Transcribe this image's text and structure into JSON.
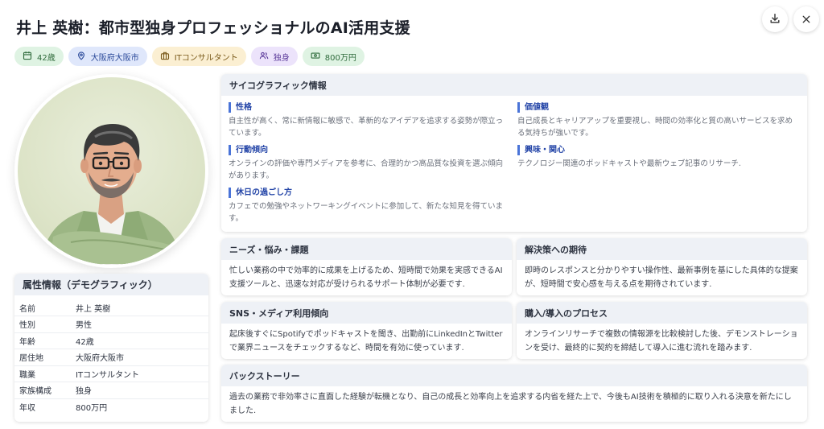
{
  "header": {
    "title": "井上 英樹：都市型独身プロフェッショナルのAI活用支援",
    "download_icon": "download-icon",
    "close_icon": "close-icon"
  },
  "tags": [
    {
      "icon": "calendar-icon",
      "label": "42歳",
      "bg": "#dff3e3",
      "fg": "#2f6b3c"
    },
    {
      "icon": "location-pin-icon",
      "label": "大阪府大阪市",
      "bg": "#dfe7fb",
      "fg": "#2b4a9a"
    },
    {
      "icon": "briefcase-icon",
      "label": "ITコンサルタント",
      "bg": "#fbefd2",
      "fg": "#7a5a1a"
    },
    {
      "icon": "people-icon",
      "label": "独身",
      "bg": "#ece3fb",
      "fg": "#5b3a9a"
    },
    {
      "icon": "money-icon",
      "label": "800万円",
      "bg": "#dff3e3",
      "fg": "#2f6b3c"
    }
  ],
  "attributes": {
    "title": "属性情報（デモグラフィック）",
    "rows": [
      {
        "key": "名前",
        "value": "井上 英樹"
      },
      {
        "key": "性別",
        "value": "男性"
      },
      {
        "key": "年齢",
        "value": "42歳"
      },
      {
        "key": "居住地",
        "value": "大阪府大阪市"
      },
      {
        "key": "職業",
        "value": "ITコンサルタント"
      },
      {
        "key": "家族構成",
        "value": "独身"
      },
      {
        "key": "年収",
        "value": "800万円"
      }
    ]
  },
  "psychographic": {
    "title": "サイコグラフィック情報",
    "personality": {
      "title": "性格",
      "text": "自主性が高く、常に新情報に敏感で、革新的なアイデアを追求する姿勢が際立っています。"
    },
    "behavior": {
      "title": "行動傾向",
      "text": "オンラインの評価や専門メディアを参考に、合理的かつ高品質な投資を選ぶ傾向があります。"
    },
    "holiday": {
      "title": "休日の過ごし方",
      "text": "カフェでの勉強やネットワーキングイベントに参加して、新たな知見を得ています。"
    },
    "values": {
      "title": "価値観",
      "text": "自己成長とキャリアアップを重要視し、時間の効率化と質の高いサービスを求める気持ちが強いです。"
    },
    "interests": {
      "title": "興味・関心",
      "text": "テクノロジー関連のポッドキャストや最新ウェブ記事のリサーチ."
    }
  },
  "needs": {
    "title": "ニーズ・悩み・課題",
    "text": "忙しい業務の中で効率的に成果を上げるため、短時間で効果を実感できるAI支援ツールと、迅速な対応が受けられるサポート体制が必要です."
  },
  "expectations": {
    "title": "解決策への期待",
    "text": "即時のレスポンスと分かりやすい操作性、最新事例を基にした具体的な提案が、短時間で安心感を与える点を期待されています."
  },
  "sns": {
    "title": "SNS・メディア利用傾向",
    "text": "起床後すぐにSpotifyでポッドキャストを聞き、出勤前にLinkedInとTwitterで業界ニュースをチェックするなど、時間を有効に使っています."
  },
  "purchase": {
    "title": "購入/導入のプロセス",
    "text": "オンラインリサーチで複数の情報源を比較検討した後、デモンストレーションを受け、最終的に契約を締結して導入に進む流れを踏みます."
  },
  "backstory": {
    "title": "バックストーリー",
    "text": "過去の業務で非効率さに直面した経験が転機となり、自己の成長と効率向上を追求する内省を経た上で、今後もAI技術を積極的に取り入れる決意を新たにしました."
  }
}
